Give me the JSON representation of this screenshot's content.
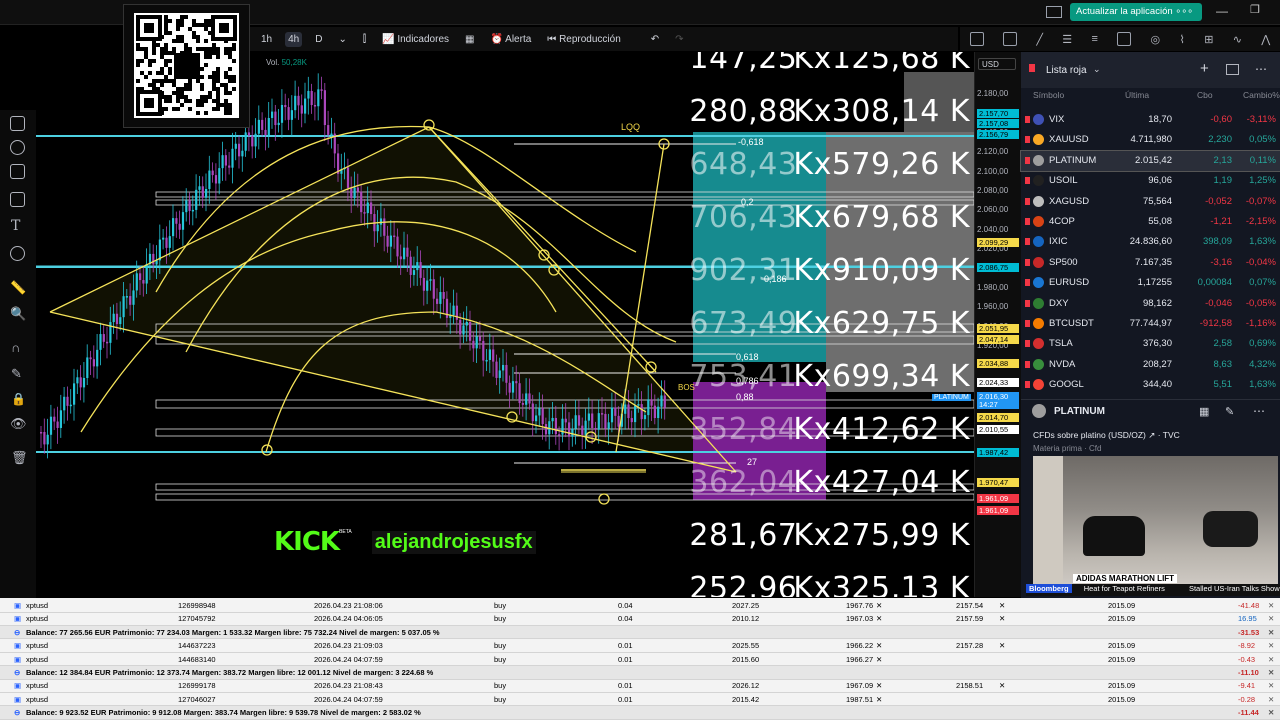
{
  "topbar": {
    "update_button": "Actualizar la aplicación"
  },
  "chart_toolbar": {
    "intervals": [
      "1h",
      "4h",
      "D"
    ],
    "selected": "4h",
    "indicators": "Indicadores",
    "alert": "Alerta",
    "replay": "Reproducción"
  },
  "legend": {
    "volume_label": "Vol.",
    "volume": "50,28K"
  },
  "currency": "USD",
  "labels": {
    "lqq": "LQQ",
    "bos": "BOS",
    "platinum_tag": "PLATINUM"
  },
  "fib_levels": [
    "-0,618",
    "0,2",
    "0,186",
    "0,618",
    "0,786",
    "0,88",
    "27"
  ],
  "overlay_rows": [
    {
      "a": "147,25",
      "b": "Kx125,68 K"
    },
    {
      "a": "280,88",
      "b": "Kx308,14 K"
    },
    {
      "a": "648,43",
      "b": "Kx579,26 K"
    },
    {
      "a": "706,43",
      "b": "Kx679,68 K"
    },
    {
      "a": "902,31",
      "b": "Kx910,09 K"
    },
    {
      "a": "673,49",
      "b": "Kx629,75 K"
    },
    {
      "a": "753,41",
      "b": "Kx699,34 K"
    },
    {
      "a": "352,84",
      "b": "Kx412,62 K"
    },
    {
      "a": "362,04",
      "b": "Kx427,04 K"
    },
    {
      "a": "281,67",
      "b": "Kx275,99 K"
    },
    {
      "a": "252,96",
      "b": "Kx325,13 K"
    }
  ],
  "price_scale": {
    "labels": [
      "2.180,00",
      "2.160,00",
      "2.140,00",
      "2.120,00",
      "2.100,00",
      "2.080,00",
      "2.060,00",
      "2.040,00",
      "2.020,00",
      "2.000,00",
      "1.980,00",
      "1.960,00",
      "1.940,00",
      "1.920,00"
    ],
    "tags": [
      {
        "v": "2.157,70",
        "c": "#00bcd4"
      },
      {
        "v": "2.157,08",
        "c": "#00bcd4"
      },
      {
        "v": "2.156,79",
        "c": "#00bcd4"
      },
      {
        "v": "2.099,29",
        "c": "#f5d94a"
      },
      {
        "v": "2.086,75",
        "c": "#00bcd4"
      },
      {
        "v": "2.051,95",
        "c": "#f5d94a"
      },
      {
        "v": "2.047,14",
        "c": "#f5d94a"
      },
      {
        "v": "2.034,88",
        "c": "#f5d94a"
      },
      {
        "v": "2.024,33",
        "c": "#ffffff"
      },
      {
        "v": "2.016,30",
        "c": "#2196f3"
      },
      {
        "v": "14:27",
        "c": "#2196f3"
      },
      {
        "v": "2.014,70",
        "c": "#f5d94a"
      },
      {
        "v": "2.010,55",
        "c": "#ffffff"
      },
      {
        "v": "1.987,42",
        "c": "#00bcd4"
      },
      {
        "v": "1.970,47",
        "c": "#f5d94a"
      },
      {
        "v": "1.961,09",
        "c": "#f23645"
      },
      {
        "v": "1.961,09",
        "c": "#f23645"
      }
    ]
  },
  "stream": {
    "badge": "KICK",
    "beta": "BETA",
    "channel": "alejandrojesusfx"
  },
  "watchlist": {
    "title": "Lista roja",
    "columns": [
      "Símbolo",
      "Última",
      "Cbo",
      "Cambio%"
    ],
    "rows": [
      {
        "sym": "VIX",
        "last": "18,70",
        "chg": "-0,60",
        "pct": "-3,11%",
        "dir": "dn",
        "icon": "#3f51b5"
      },
      {
        "sym": "XAUUSD",
        "last": "4.711,980",
        "chg": "2,230",
        "pct": "0,05%",
        "dir": "up",
        "icon": "#f9a825"
      },
      {
        "sym": "PLATINUM",
        "last": "2.015,42",
        "chg": "2,13",
        "pct": "0,11%",
        "dir": "up",
        "icon": "#9e9e9e"
      },
      {
        "sym": "USOIL",
        "last": "96,06",
        "chg": "1,19",
        "pct": "1,25%",
        "dir": "up",
        "icon": "#212121"
      },
      {
        "sym": "XAGUSD",
        "last": "75,564",
        "chg": "-0,052",
        "pct": "-0,07%",
        "dir": "dn",
        "icon": "#bdbdbd"
      },
      {
        "sym": "4COP",
        "last": "55,08",
        "chg": "-1,21",
        "pct": "-2,15%",
        "dir": "dn",
        "icon": "#d84315"
      },
      {
        "sym": "IXIC",
        "last": "24.836,60",
        "chg": "398,09",
        "pct": "1,63%",
        "dir": "up",
        "icon": "#1565c0"
      },
      {
        "sym": "SP500",
        "last": "7.167,35",
        "chg": "-3,16",
        "pct": "-0,04%",
        "dir": "dn",
        "icon": "#c62828"
      },
      {
        "sym": "EURUSD",
        "last": "1,17255",
        "chg": "0,00084",
        "pct": "0,07%",
        "dir": "up",
        "icon": "#1976d2"
      },
      {
        "sym": "DXY",
        "last": "98,162",
        "chg": "-0,046",
        "pct": "-0,05%",
        "dir": "dn",
        "icon": "#2e7d32"
      },
      {
        "sym": "BTCUSDT",
        "last": "77.744,97",
        "chg": "-912,58",
        "pct": "-1,16%",
        "dir": "dn",
        "icon": "#f57c00"
      },
      {
        "sym": "TSLA",
        "last": "376,30",
        "chg": "2,58",
        "pct": "0,69%",
        "dir": "up",
        "icon": "#d32f2f"
      },
      {
        "sym": "NVDA",
        "last": "208,27",
        "chg": "8,63",
        "pct": "4,32%",
        "dir": "up",
        "icon": "#388e3c"
      },
      {
        "sym": "GOOGL",
        "last": "344,40",
        "chg": "5,51",
        "pct": "1,63%",
        "dir": "up",
        "icon": "#f44336"
      }
    ]
  },
  "detail": {
    "symbol": "PLATINUM",
    "desc": "CFDs sobre platino (USD/OZ)",
    "source": "TVC",
    "category": "Materia prima · Cfd",
    "caption": "ADIDAS MARATHON LIFT"
  },
  "news": {
    "brand": "Bloomberg",
    "h1": "Heat for Teapot Refiners",
    "h2": "Stalled US-Iran Talks Show Lim"
  },
  "positions": [
    {
      "type": "row",
      "sym": "xptusd",
      "id": "126998948",
      "time": "2026.04.23 21:08:06",
      "side": "buy",
      "vol": "0.04",
      "open": "2027.25",
      "sl": "1967.76",
      "tp": "2157.54",
      "price": "2015.09",
      "pnl": "-41.48",
      "neg": true
    },
    {
      "type": "row",
      "sym": "xptusd",
      "id": "127045792",
      "time": "2026.04.24 04:06:05",
      "side": "buy",
      "vol": "0.04",
      "open": "2010.12",
      "sl": "1967.03",
      "tp": "2157.59",
      "price": "2015.09",
      "pnl": "16.95",
      "neg": false
    },
    {
      "type": "bal",
      "text": "Balance: 77 265.56 EUR  Patrimonio: 77 234.03  Margen: 1 533.32  Margen libre: 75 732.24  Nivel de margen: 5 037.05 %",
      "pnl": "-31.53"
    },
    {
      "type": "row",
      "sym": "xptusd",
      "id": "144637223",
      "time": "2026.04.23 21:09:03",
      "side": "buy",
      "vol": "0.01",
      "open": "2025.55",
      "sl": "1966.22",
      "tp": "2157.28",
      "price": "2015.09",
      "pnl": "-8.92",
      "neg": true
    },
    {
      "type": "row",
      "sym": "xptusd",
      "id": "144683140",
      "time": "2026.04.24 04:07:59",
      "side": "buy",
      "vol": "0.01",
      "open": "2015.60",
      "sl": "1966.27",
      "tp": "",
      "price": "2015.09",
      "pnl": "-0.43",
      "neg": true
    },
    {
      "type": "bal",
      "text": "Balance: 12 384.84 EUR  Patrimonio: 12 373.74  Margen: 383.72  Margen libre: 12 001.12  Nivel de margen: 3 224.68 %",
      "pnl": "-11.10"
    },
    {
      "type": "row",
      "sym": "xptusd",
      "id": "126999178",
      "time": "2026.04.23 21:08:43",
      "side": "buy",
      "vol": "0.01",
      "open": "2026.12",
      "sl": "1967.09",
      "tp": "2158.51",
      "price": "2015.09",
      "pnl": "-9.41",
      "neg": true
    },
    {
      "type": "row",
      "sym": "xptusd",
      "id": "127046027",
      "time": "2026.04.24 04:07:59",
      "side": "buy",
      "vol": "0.01",
      "open": "2015.42",
      "sl": "1987.51",
      "tp": "",
      "price": "2015.09",
      "pnl": "-0.28",
      "neg": true
    },
    {
      "type": "bal",
      "text": "Balance: 9 923.52 EUR  Patrimonio: 9 912.08  Margen: 383.74  Margen libre: 9 539.78  Nivel de margen: 2 583.02 %",
      "pnl": "-11.44"
    }
  ]
}
